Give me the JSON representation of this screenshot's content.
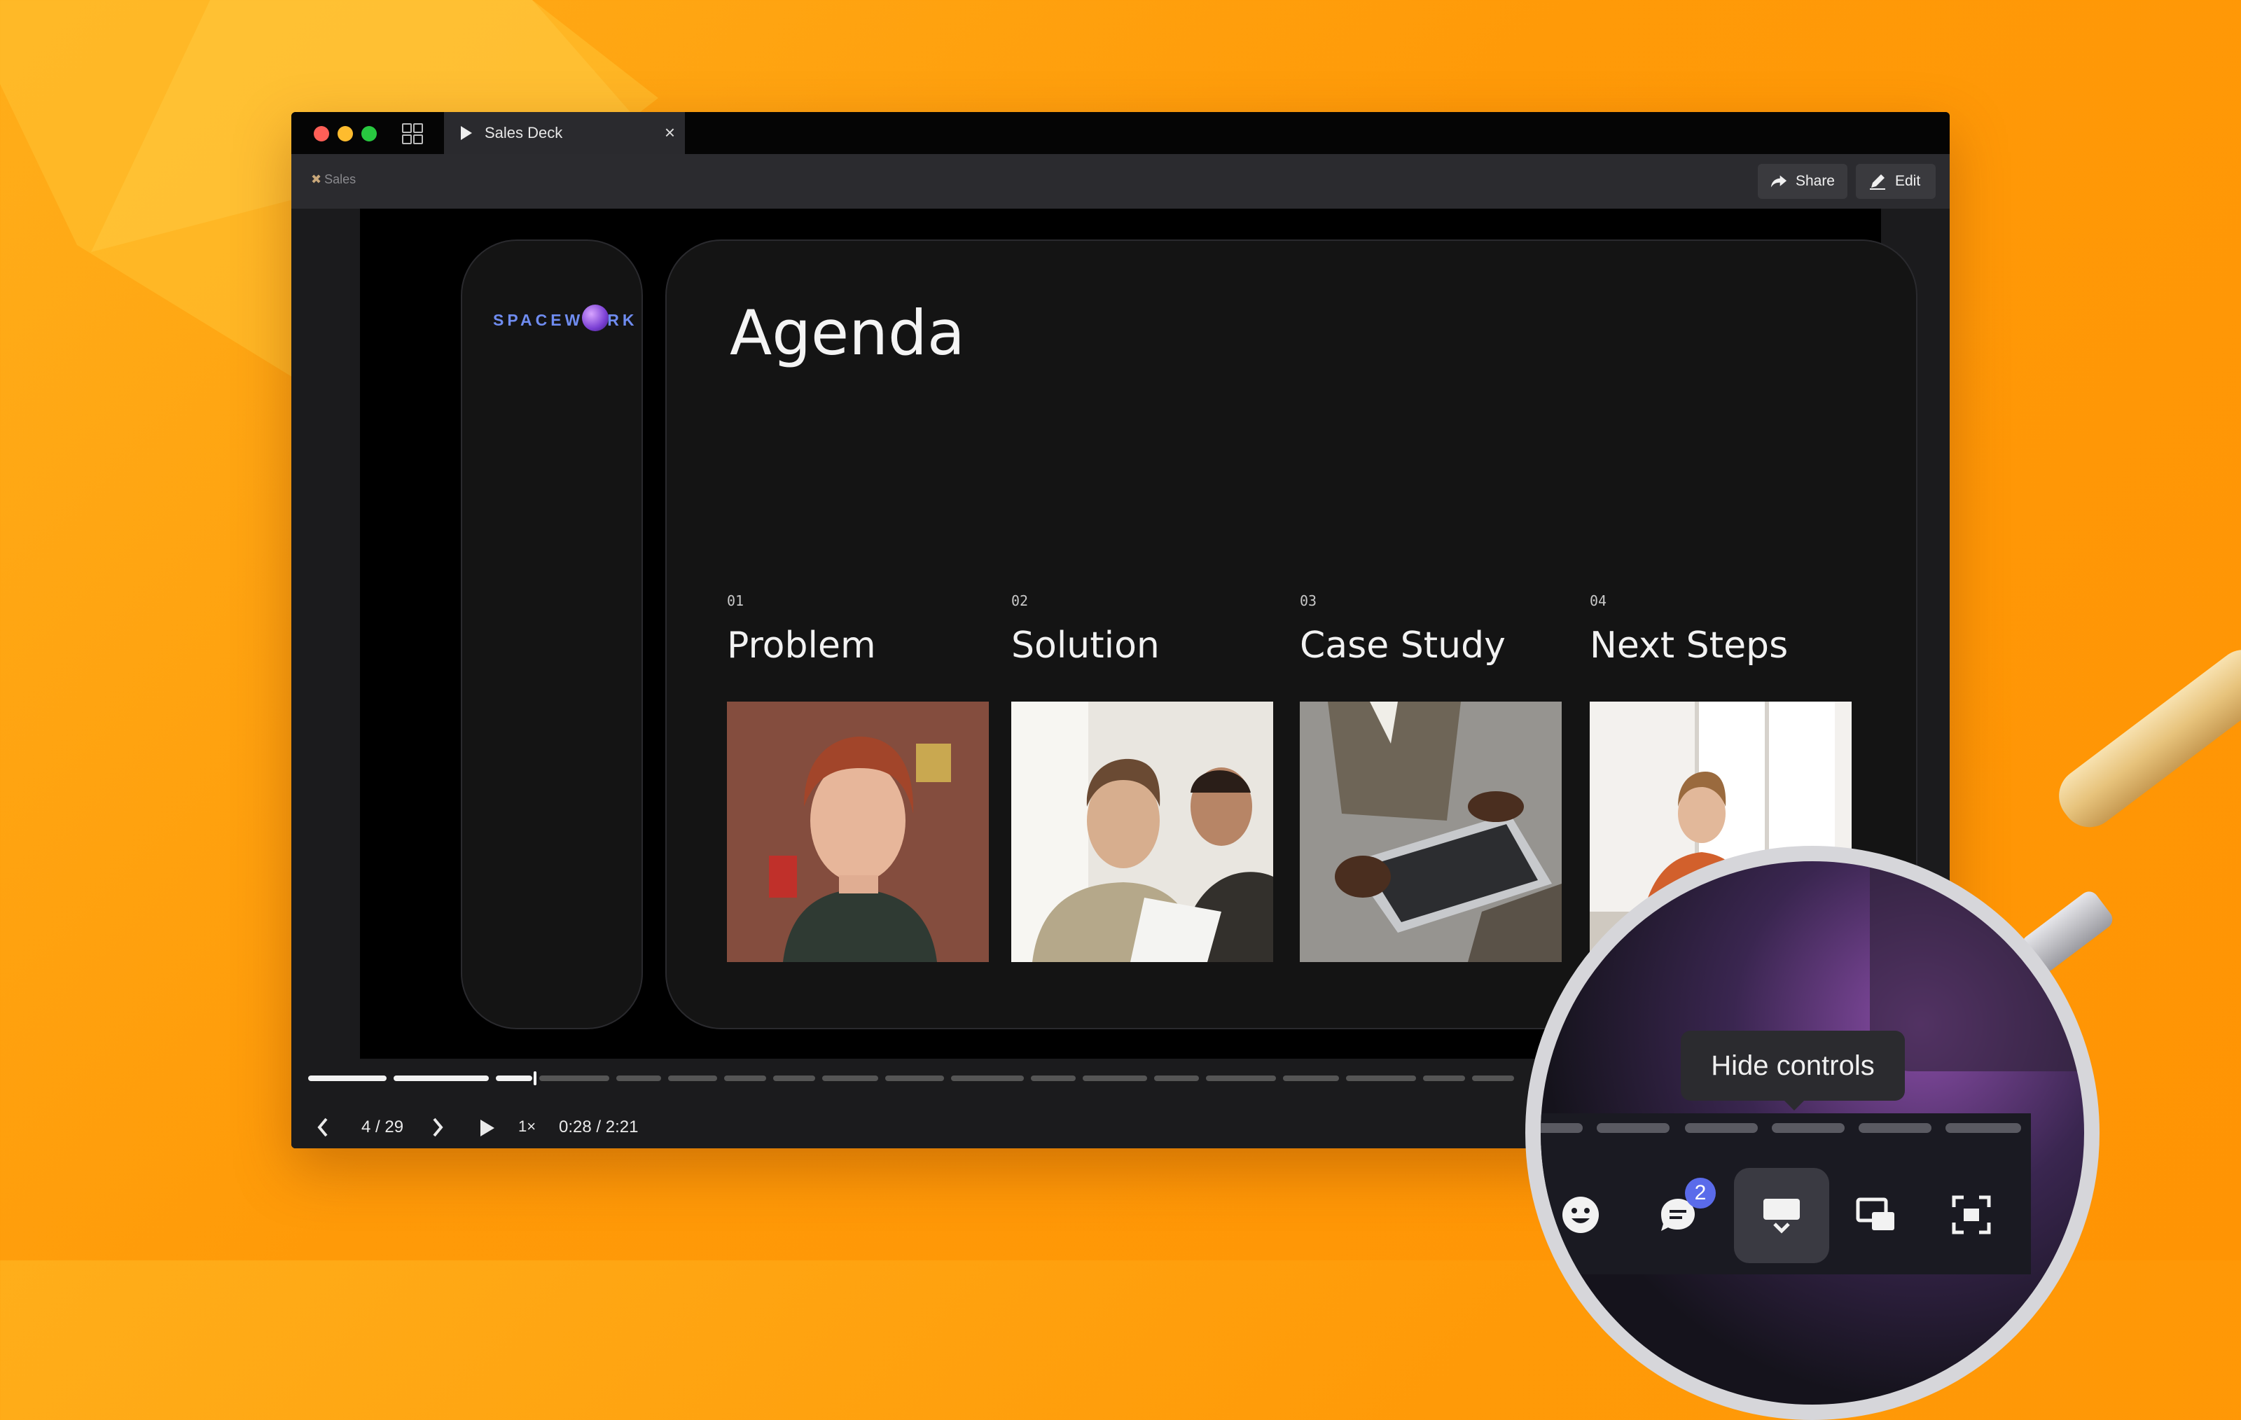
{
  "tab": {
    "title": "Sales Deck"
  },
  "toolbar": {
    "breadcrumb": "Sales",
    "share_label": "Share",
    "edit_label": "Edit"
  },
  "slide": {
    "logo": {
      "before": "SPACEW",
      "after": "RK"
    },
    "title": "Agenda",
    "items": [
      {
        "num": "01",
        "label": "Problem"
      },
      {
        "num": "02",
        "label": "Solution"
      },
      {
        "num": "03",
        "label": "Case Study"
      },
      {
        "num": "04",
        "label": "Next Steps"
      }
    ]
  },
  "player": {
    "page_indicator": "4 / 29",
    "speed": "1×",
    "time": "0:28 / 2:21",
    "progress_fraction": 0.14
  },
  "magnifier": {
    "tooltip": "Hide controls",
    "comments_badge": "2"
  },
  "colors": {
    "background": "#ff9a08",
    "accent_badge": "#5a6bea",
    "close": "#ff5f57",
    "minimize": "#febc2e",
    "maximize": "#28c840"
  }
}
